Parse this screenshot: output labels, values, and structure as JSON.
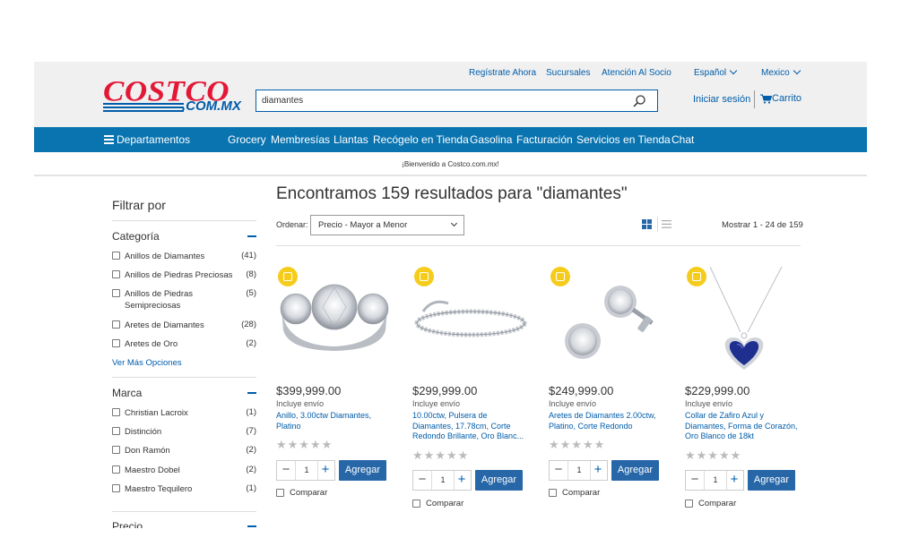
{
  "header": {
    "logo_main": "COSTCO",
    "logo_domain": ".COM.MX",
    "top_links": [
      "Regístrate Ahora",
      "Sucursales",
      "Atención Al Socio"
    ],
    "language": "Español",
    "country": "Mexico",
    "search_value": "diamantes",
    "signin": "Iniciar sesión",
    "cart": "Carrito"
  },
  "nav": {
    "departments": "Departamentos",
    "items": [
      "Grocery",
      "Membresías",
      "Llantas",
      "Recógelo en Tienda",
      "Gasolina",
      "Facturación",
      "Servicios en Tienda",
      "Chat"
    ]
  },
  "welcome": "¡Bienvenido a Costco.com.mx!",
  "sidebar": {
    "title": "Filtrar por",
    "categoria": {
      "title": "Categoría",
      "options": [
        {
          "label": "Anillos de Diamantes",
          "count": "(41)"
        },
        {
          "label": "Anillos de Piedras Preciosas",
          "count": "(8)"
        },
        {
          "label": "Anillos de Piedras Semipreciosas",
          "count": "(5)"
        },
        {
          "label": "Aretes de Diamantes",
          "count": "(28)"
        },
        {
          "label": "Aretes de Oro",
          "count": "(2)"
        }
      ],
      "more": "Ver Más Opciones"
    },
    "marca": {
      "title": "Marca",
      "options": [
        {
          "label": "Christian Lacroix",
          "count": "(1)"
        },
        {
          "label": "Distinción",
          "count": "(7)"
        },
        {
          "label": "Don Ramón",
          "count": "(2)"
        },
        {
          "label": "Maestro Dobel",
          "count": "(2)"
        },
        {
          "label": "Maestro Tequilero",
          "count": "(1)"
        }
      ]
    },
    "precio": {
      "title": "Precio"
    }
  },
  "results": {
    "title": "Encontramos 159 resultados para \"diamantes\"",
    "sort_label": "Ordenar:",
    "sort_value": "Precio - Mayor a Menor",
    "showing": "Mostrar 1 - 24 de 159"
  },
  "products": [
    {
      "price": "$399,999.00",
      "shipping": "Incluye envío",
      "name": "Anillo, 3.00ctw Diamantes, Platino",
      "qty": "1",
      "add": "Agregar",
      "compare": "Comparar",
      "stars": "★★★★★"
    },
    {
      "price": "$299,999.00",
      "shipping": "Incluye envío",
      "name": "10.00ctw, Pulsera de Diamantes, 17.78cm, Corte Redondo Brillante, Oro Blanc...",
      "qty": "1",
      "add": "Agregar",
      "compare": "Comparar",
      "stars": "★★★★★"
    },
    {
      "price": "$249,999.00",
      "shipping": "Incluye envío",
      "name": "Aretes de Diamantes 2.00ctw, Platino, Corte Redondo",
      "qty": "1",
      "add": "Agregar",
      "compare": "Comparar",
      "stars": "★★★★★"
    },
    {
      "price": "$229,999.00",
      "shipping": "Incluye envío",
      "name": "Collar de Zafiro Azul y Diamantes, Forma de Corazón, Oro Blanco de 18kt",
      "qty": "1",
      "add": "Agregar",
      "compare": "Comparar",
      "stars": "★★★★★"
    }
  ],
  "colors": {
    "brand_red": "#e31837",
    "brand_blue": "#005daa",
    "nav_blue": "#0a74b0",
    "badge_gold": "#f6cc1c"
  }
}
